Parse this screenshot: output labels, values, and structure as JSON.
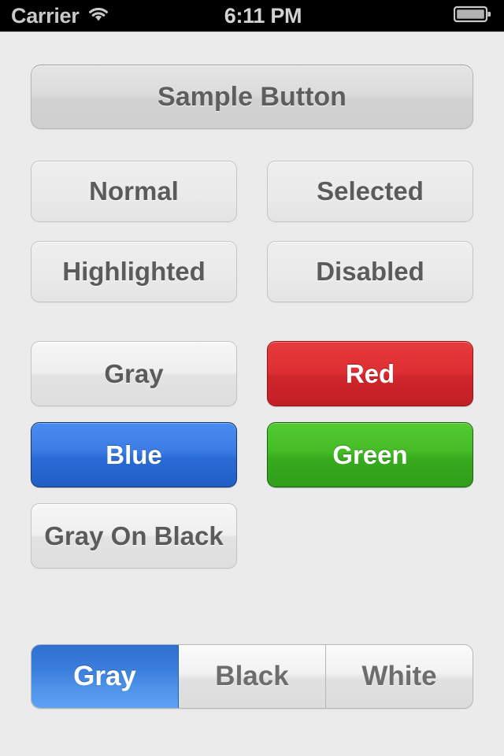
{
  "status_bar": {
    "carrier": "Carrier",
    "wifi_icon": "wifi-icon",
    "time": "6:11 PM",
    "battery_icon": "battery-full-icon"
  },
  "theme": {
    "background": "#ebebeb",
    "status_bar_background": "#000000",
    "status_bar_text": "#c9c9c9",
    "gray_button_text": "#5b5b5b",
    "red": "#d32b30",
    "blue": "#2f7ae0",
    "green": "#3cb423",
    "segment_selected": "#3b7fdd"
  },
  "main": {
    "sample_button": {
      "label": "Sample Button",
      "style": "gradient-gray"
    },
    "state_buttons": [
      {
        "label": "Normal",
        "style": "flat-gray"
      },
      {
        "label": "Selected",
        "style": "flat-gray"
      },
      {
        "label": "Highlighted",
        "style": "flat-gray"
      },
      {
        "label": "Disabled",
        "style": "flat-gray"
      }
    ],
    "color_buttons": [
      {
        "label": "Gray",
        "style": "glossy-gray"
      },
      {
        "label": "Red",
        "style": "red"
      },
      {
        "label": "Blue",
        "style": "blue"
      },
      {
        "label": "Green",
        "style": "green"
      },
      {
        "label": "Gray On Black",
        "style": "glossy-gray"
      }
    ],
    "segmented_control": {
      "segments": [
        {
          "label": "Gray",
          "selected": true
        },
        {
          "label": "Black",
          "selected": false
        },
        {
          "label": "White",
          "selected": false
        }
      ]
    }
  }
}
